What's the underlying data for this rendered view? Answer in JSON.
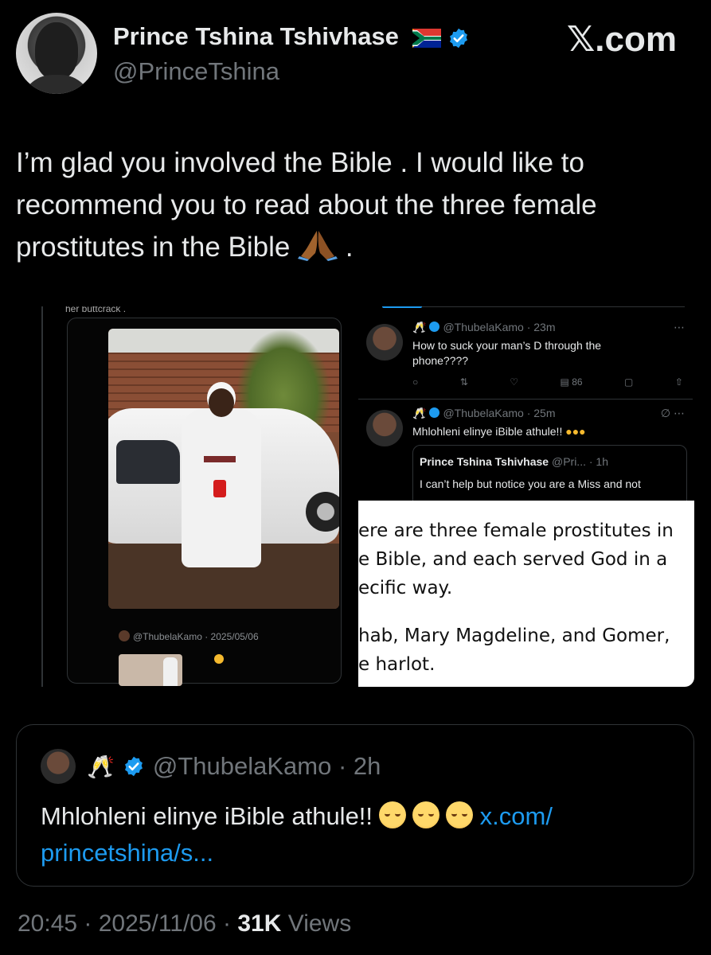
{
  "author": {
    "name": "Prince Tshina Tshivhase",
    "handle": "@PrinceTshina",
    "flag_icon": "south-africa-flag",
    "verified_color": "#1d9bf0"
  },
  "watermark": "𝕏.com",
  "tweet": {
    "text": "I’m glad you involved the Bible . I would like to recommend you to read about the three  female prostitutes in the Bible",
    "tail": " ."
  },
  "media": {
    "cut_text": "her buttcrack .",
    "left_sub_handle": "@ThubelaKamo · 2025/05/06",
    "posts": [
      {
        "handle": "@ThubelaKamo · 23m",
        "text": "How to suck your man’s D through the phone????",
        "views": "86"
      },
      {
        "handle": "@ThubelaKamo · 25m",
        "text": "Mhlohleni elinye iBible athule!!"
      }
    ],
    "nested": {
      "name": "Prince Tshina Tshivhase",
      "handle": "@Pri... · 1h",
      "text": "I can’t help but notice you are a Miss and not"
    },
    "white_card_lines": [
      "ere are three female prostitutes in",
      "e Bible, and each served God in a",
      "ecific way."
    ],
    "white_card_lines_2": [
      "hab, Mary Magdeline, and Gomer,",
      "e harlot."
    ]
  },
  "quote": {
    "handle": "@ThubelaKamo",
    "time": "2h",
    "text": "Mhlohleni elinye iBible athule!!",
    "link": "x.com/ princetshina/s..."
  },
  "footer": {
    "time": "20:45",
    "date": "2025/11/06",
    "views_count": "31K",
    "views_label": "Views"
  }
}
